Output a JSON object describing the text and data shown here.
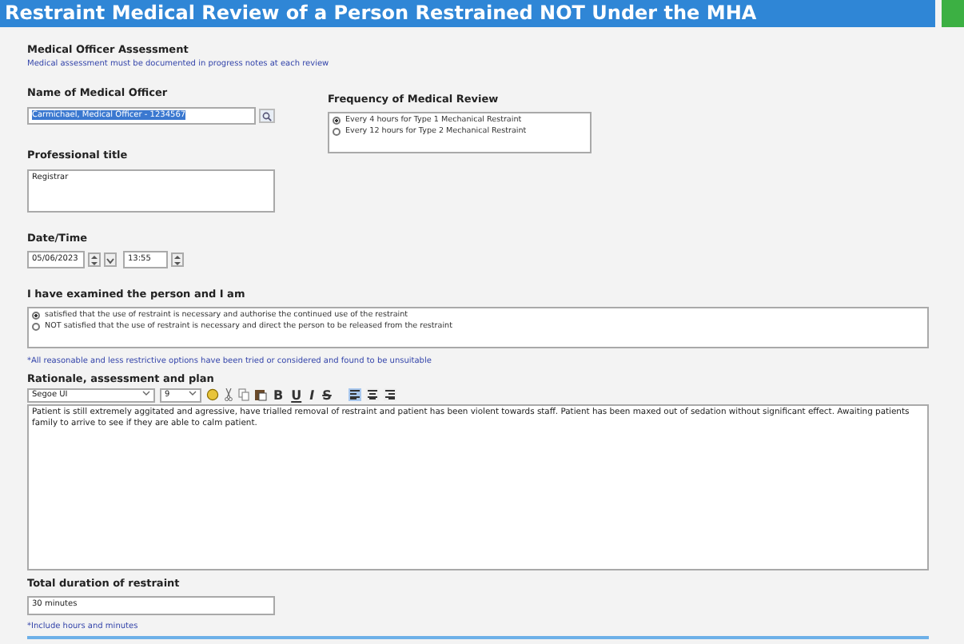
{
  "title": "Restraint Medical Review of a Person Restrained NOT Under the MHA",
  "assessment": {
    "heading": "Medical Officer Assessment",
    "note": "Medical assessment must be documented in progress notes at each review"
  },
  "officer": {
    "label": "Name of Medical Officer",
    "value": "Carmichael, Medical Officer - 1234567",
    "highlighted": true
  },
  "frequency": {
    "label": "Frequency of Medical Review",
    "options": [
      {
        "label": "Every 4 hours for Type 1 Mechanical Restraint",
        "selected": true
      },
      {
        "label": "Every 12 hours for Type 2 Mechanical Restraint",
        "selected": false
      }
    ]
  },
  "professional_title": {
    "label": "Professional title",
    "value": "Registrar"
  },
  "datetime": {
    "label": "Date/Time",
    "date": "05/06/2023",
    "time": "13:55"
  },
  "examined": {
    "label": "I have examined the person and I am",
    "options": [
      {
        "label": "satisfied that the use of restraint is necessary and authorise the continued use of the restraint",
        "selected": true
      },
      {
        "label": "NOT satisfied that the use of restraint is necessary and direct the person to be released from the restraint",
        "selected": false
      }
    ],
    "note": "*All reasonable and less restrictive options have been tried or considered and found to be unsuitable"
  },
  "rationale": {
    "label": "Rationale, assessment and plan",
    "font": "Segoe UI",
    "size": "9",
    "format_buttons": [
      {
        "kind": "bold",
        "text": "B"
      },
      {
        "kind": "underline",
        "text": "U"
      },
      {
        "kind": "italic",
        "text": "I"
      },
      {
        "kind": "strike",
        "text": "S"
      }
    ],
    "align_buttons": [
      {
        "kind": "left",
        "selected": true
      },
      {
        "kind": "center",
        "selected": false
      },
      {
        "kind": "right",
        "selected": false
      }
    ],
    "value": "Patient is still extremely aggitated and agressive, have trialled removal of restraint and patient has been violent towards staff. Patient has been maxed out of sedation without significant effect. Awaiting patients family to arrive to see if they are able to calm patient."
  },
  "duration": {
    "label": "Total duration of restraint",
    "value": "30 minutes",
    "note": "*Include hours and minutes"
  }
}
